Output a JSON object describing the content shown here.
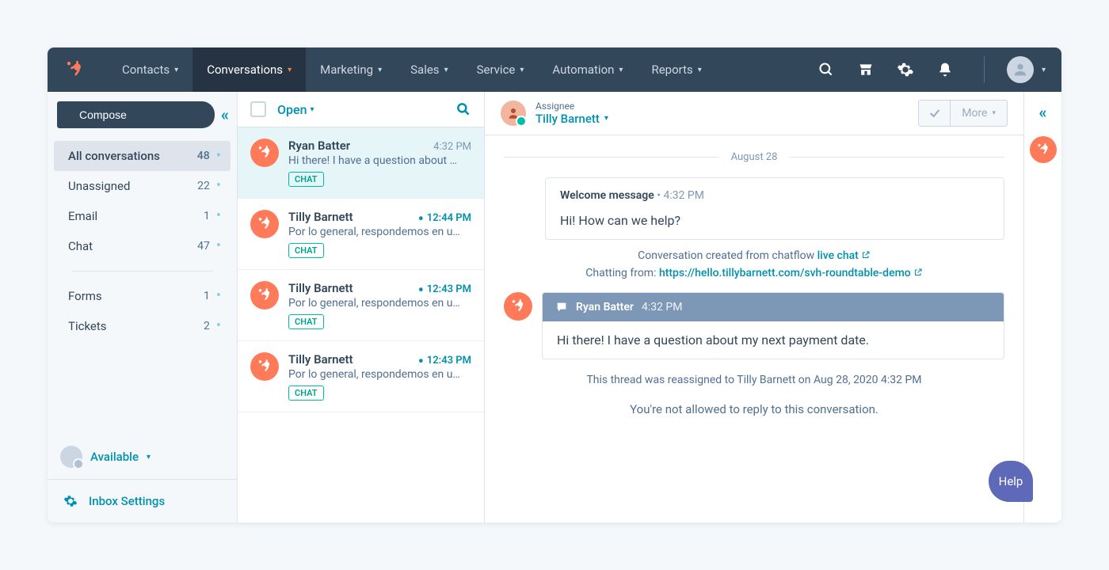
{
  "nav": {
    "items": [
      "Contacts",
      "Conversations",
      "Marketing",
      "Sales",
      "Service",
      "Automation",
      "Reports"
    ],
    "active_index": 1
  },
  "sidebar": {
    "compose": "Compose",
    "folders": [
      {
        "label": "All conversations",
        "count": "48",
        "selected": true
      },
      {
        "label": "Unassigned",
        "count": "22",
        "selected": false
      },
      {
        "label": "Email",
        "count": "1",
        "selected": false
      },
      {
        "label": "Chat",
        "count": "47",
        "selected": false
      }
    ],
    "lower_folders": [
      {
        "label": "Forms",
        "count": "1"
      },
      {
        "label": "Tickets",
        "count": "2"
      }
    ],
    "available": "Available",
    "inbox_settings": "Inbox Settings"
  },
  "threads_header": {
    "filter": "Open"
  },
  "threads": [
    {
      "name": "Ryan Batter",
      "time": "4:32 PM",
      "unread": false,
      "preview": "Hi there! I have a question about …",
      "tag": "CHAT",
      "selected": true
    },
    {
      "name": "Tilly Barnett",
      "time": "12:44 PM",
      "unread": true,
      "preview": "Por lo general, respondemos en u…",
      "tag": "CHAT",
      "selected": false
    },
    {
      "name": "Tilly Barnett",
      "time": "12:43 PM",
      "unread": true,
      "preview": "Por lo general, respondemos en u…",
      "tag": "CHAT",
      "selected": false
    },
    {
      "name": "Tilly Barnett",
      "time": "12:43 PM",
      "unread": true,
      "preview": "Por lo general, respondemos en u…",
      "tag": "CHAT",
      "selected": false
    }
  ],
  "convo": {
    "assignee_label": "Assignee",
    "assignee_name": "Tilly Barnett",
    "more": "More",
    "date": "August 28",
    "welcome_title": "Welcome message",
    "welcome_time": "4:32 PM",
    "welcome_body": "Hi! How can we help?",
    "created_prefix": "Conversation created from chatflow ",
    "created_link": "live chat",
    "chatting_prefix": "Chatting from: ",
    "chatting_link": "https://hello.tillybarnett.com/svh-roundtable-demo",
    "msg_sender": "Ryan Batter",
    "msg_time": "4:32 PM",
    "msg_body": "Hi there! I have a question about my next payment date.",
    "reassign": "This thread was reassigned to Tilly Barnett on Aug 28, 2020 4:32 PM",
    "noreply": "You're not allowed to reply to this conversation."
  },
  "help": "Help"
}
